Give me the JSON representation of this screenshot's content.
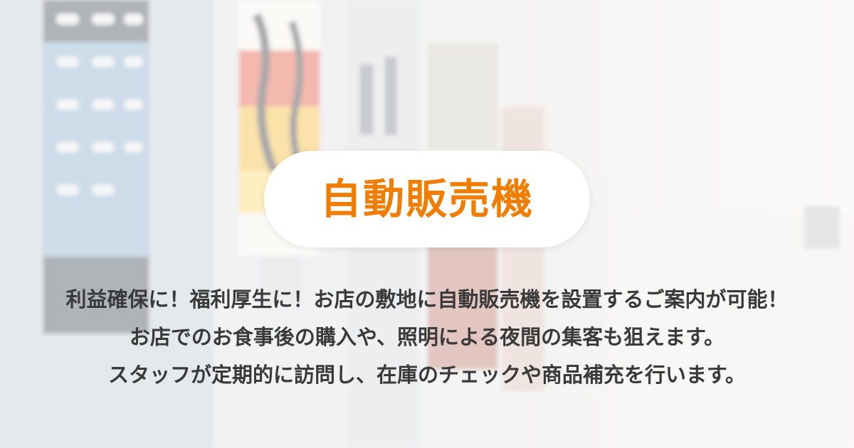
{
  "title": "自動販売機",
  "lines": [
    "利益確保に！福利厚生に！お店の敷地に自動販売機を設置するご案内が可能！",
    "お店でのお食事後の購入や、照明による夜間の集客も狙えます。",
    "スタッフが定期的に訪問し、在庫のチェックや商品補充を行います。"
  ],
  "colors": {
    "title": "#ee7d00",
    "highlight": "#ffd21f",
    "text": "#3a3a3a",
    "pill": "#ffffff"
  },
  "icons": [
    "vending-machine-photo-background"
  ]
}
